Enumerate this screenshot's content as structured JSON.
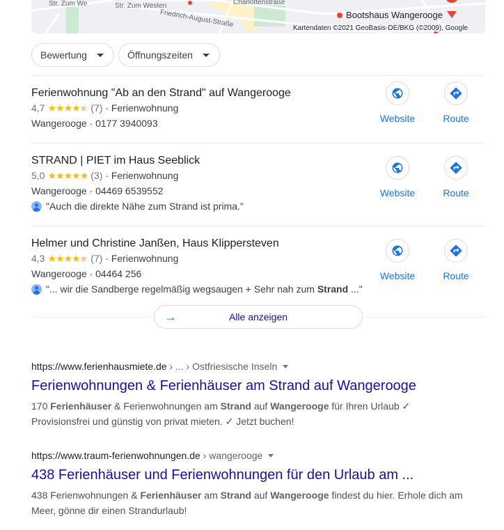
{
  "map": {
    "streets": [
      "Str. Zum We",
      "Str. Zum Westen",
      "Friedrich-August-Straße",
      "Charlottenstraße"
    ],
    "poi": "Bootshaus Wangerooge",
    "attribution": "Kartendaten ©2021 GeoBasis-DE/BKG (©2009), Google"
  },
  "filters": [
    {
      "label": "Bewertung"
    },
    {
      "label": "Öffnungszeiten"
    }
  ],
  "listings": [
    {
      "title": "Ferienwohnung \"Ab an den Strand\" auf Wangerooge",
      "rating": "4,7",
      "rating_value": 4.7,
      "count": "(7)",
      "type": "· Ferienwohnung",
      "address": "Wangerooge · 0177 3940093",
      "website": "Website",
      "route": "Route"
    },
    {
      "title": "STRAND | PIET im Haus Seeblick",
      "rating": "5,0",
      "rating_value": 5.0,
      "count": "(3)",
      "type": "· Ferienwohnung",
      "address": "Wangerooge · 04469 6539552",
      "review": "\"Auch die direkte Nähe zum Strand ist prima.\"",
      "website": "Website",
      "route": "Route"
    },
    {
      "title": "Helmer und Christine Janßen, Haus Klippersteven",
      "rating": "4,3",
      "rating_value": 4.3,
      "count": "(7)",
      "type": "· Ferienwohnung",
      "address": "Wangerooge · 04464 256",
      "review_parts": [
        {
          "t": "\"... wir die Sandberge regelmäßig wegsaugen + Sehr nah zum ",
          "b": false
        },
        {
          "t": "Strand",
          "b": true
        },
        {
          "t": " ...\"",
          "b": false
        }
      ],
      "website": "Website",
      "route": "Route"
    }
  ],
  "show_all": "Alle anzeigen",
  "results": [
    {
      "domain": "https://www.ferienhausmiete.de",
      "breadcrumb": " › ... › Ostfriesische Inseln",
      "title": "Ferienwohnungen & Ferienhäuser am Strand auf Wangerooge",
      "snippet": [
        {
          "t": "170 ",
          "b": false
        },
        {
          "t": "Ferienhäuser",
          "b": true
        },
        {
          "t": " & Ferienwohnungen am ",
          "b": false
        },
        {
          "t": "Strand",
          "b": true
        },
        {
          "t": " auf ",
          "b": false
        },
        {
          "t": "Wangerooge",
          "b": true
        },
        {
          "t": " für Ihren Urlaub ✓ Provisionsfrei und günstig von privat mieten. ✓ Jetzt buchen!",
          "b": false
        }
      ]
    },
    {
      "domain": "https://www.traum-ferienwohnungen.de",
      "breadcrumb": " › wangerooge",
      "title": "438 Ferienhäuser und Ferienwohnungen für den Urlaub am ...",
      "snippet": [
        {
          "t": "438 Ferienwohnungen & ",
          "b": false
        },
        {
          "t": "Ferienhäuser",
          "b": true
        },
        {
          "t": " am ",
          "b": false
        },
        {
          "t": "Strand",
          "b": true
        },
        {
          "t": " auf ",
          "b": false
        },
        {
          "t": "Wangerooge",
          "b": true
        },
        {
          "t": " findest du hier. Erhole dich am Meer, gönne dir einen Strandurlaub!",
          "b": false
        }
      ]
    }
  ],
  "colors": {
    "link": "#1a0dab",
    "accent": "#1a73e8",
    "star": "#fbbc04",
    "pin": "#ea4335"
  }
}
